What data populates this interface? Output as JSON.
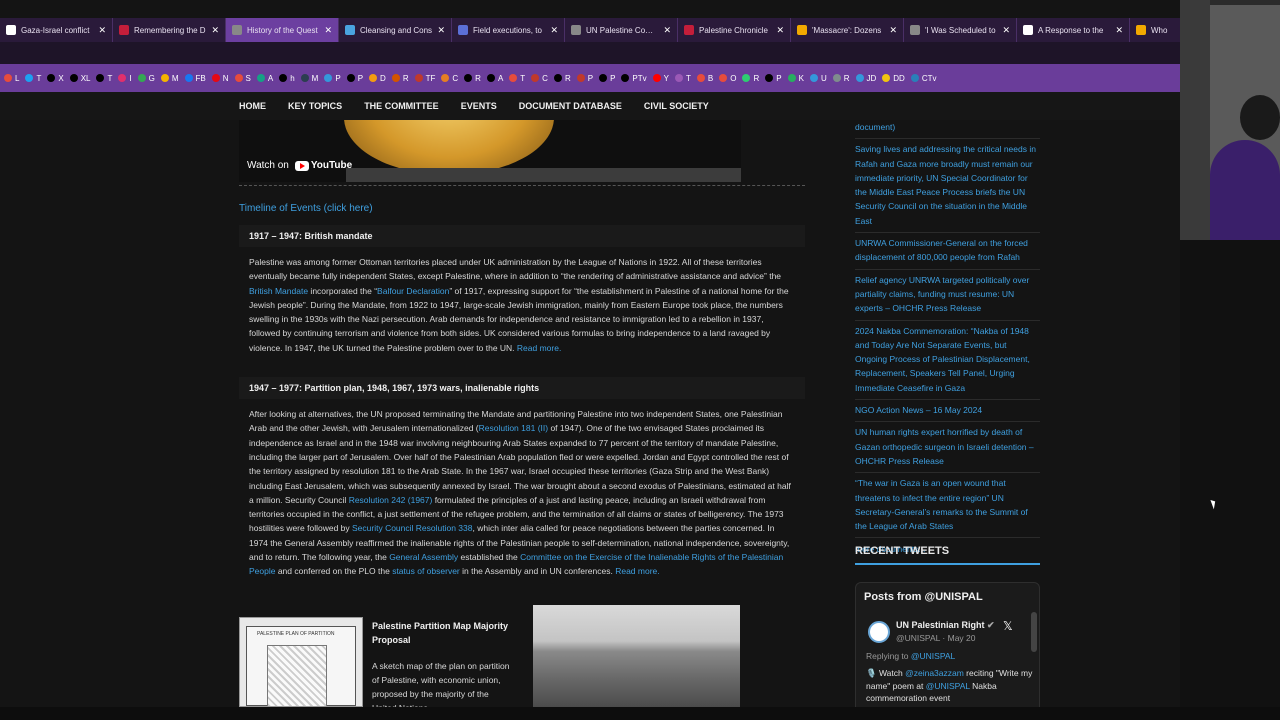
{
  "browser": {
    "tabs": [
      {
        "label": "Gaza-Israel conflict",
        "color": "#ffffff",
        "active": false
      },
      {
        "label": "Remembering the D",
        "color": "#c41e3a",
        "active": false
      },
      {
        "label": "History of the Quest",
        "color": "#888888",
        "active": true
      },
      {
        "label": "Cleansing and Cons",
        "color": "#4aa3df",
        "active": false
      },
      {
        "label": "Field executions, to",
        "color": "#5b6fd6",
        "active": false
      },
      {
        "label": "UN Palestine Commi",
        "color": "#888888",
        "active": false
      },
      {
        "label": "Palestine Chronicle",
        "color": "#c41e3a",
        "active": false
      },
      {
        "label": "'Massacre': Dozens",
        "color": "#f2a900",
        "active": false
      },
      {
        "label": "'I Was Scheduled to",
        "color": "#888888",
        "active": false
      },
      {
        "label": "A Response to the",
        "color": "#ffffff",
        "active": false
      },
      {
        "label": "Who",
        "color": "#f2a900",
        "active": false
      }
    ],
    "bookmarks": [
      {
        "label": "L",
        "color": "#e74c3c"
      },
      {
        "label": "T",
        "color": "#1da1f2"
      },
      {
        "label": "X",
        "color": "#000000"
      },
      {
        "label": "XL",
        "color": "#000000"
      },
      {
        "label": "T",
        "color": "#000000"
      },
      {
        "label": "I",
        "color": "#e1306c"
      },
      {
        "label": "G",
        "color": "#34a853"
      },
      {
        "label": "M",
        "color": "#f4b400"
      },
      {
        "label": "FB",
        "color": "#1877f2"
      },
      {
        "label": "N",
        "color": "#e50914"
      },
      {
        "label": "S",
        "color": "#e74c3c"
      },
      {
        "label": "A",
        "color": "#16a085"
      },
      {
        "label": "h",
        "color": "#000000"
      },
      {
        "label": "M",
        "color": "#2c3e50"
      },
      {
        "label": "P",
        "color": "#3498db"
      },
      {
        "label": "P",
        "color": "#000000"
      },
      {
        "label": "D",
        "color": "#f39c12"
      },
      {
        "label": "R",
        "color": "#d35400"
      },
      {
        "label": "TF",
        "color": "#c0392b"
      },
      {
        "label": "C",
        "color": "#e67e22"
      },
      {
        "label": "R",
        "color": "#000000"
      },
      {
        "label": "A",
        "color": "#000000"
      },
      {
        "label": "T",
        "color": "#e74c3c"
      },
      {
        "label": "C",
        "color": "#c0392b"
      },
      {
        "label": "R",
        "color": "#000000"
      },
      {
        "label": "P",
        "color": "#c0392b"
      },
      {
        "label": "P",
        "color": "#000000"
      },
      {
        "label": "PTv",
        "color": "#000000"
      },
      {
        "label": "Y",
        "color": "#ff0000"
      },
      {
        "label": "T",
        "color": "#9b59b6"
      },
      {
        "label": "B",
        "color": "#e74c3c"
      },
      {
        "label": "O",
        "color": "#e74c3c"
      },
      {
        "label": "R",
        "color": "#2ecc71"
      },
      {
        "label": "P",
        "color": "#000000"
      },
      {
        "label": "K",
        "color": "#27ae60"
      },
      {
        "label": "U",
        "color": "#3498db"
      },
      {
        "label": "R",
        "color": "#7f8c8d"
      },
      {
        "label": "JD",
        "color": "#3498db"
      },
      {
        "label": "DD",
        "color": "#f1c40f"
      },
      {
        "label": "CTv",
        "color": "#2980b9"
      }
    ]
  },
  "nav": {
    "items": [
      "HOME",
      "KEY TOPICS",
      "THE COMMITTEE",
      "EVENTS",
      "DOCUMENT DATABASE",
      "CIVIL SOCIETY"
    ]
  },
  "video": {
    "watch_label": "Watch on",
    "brand": "YouTube"
  },
  "main": {
    "timeline_link": "Timeline of Events (click here)",
    "section1_title": "1917 – 1947: British mandate",
    "section1": {
      "t1": "Palestine was among former Ottoman territories placed under UK administration by the League of Nations in 1922. All of these territories eventually became fully independent States, except Palestine, where in addition to “the rendering of administrative assistance and advice” the ",
      "l1": "British Mandate",
      "t2": " incorporated the “",
      "l2": "Balfour Declaration",
      "t3": "” of 1917, expressing support for “the establishment in Palestine of a national home for the Jewish people”. During the Mandate, from 1922 to 1947, large-scale Jewish immigration, mainly from Eastern Europe took place, the numbers swelling in the 1930s with the Nazi persecution. Arab demands for independence and resistance to immigration led to a rebellion in 1937, followed by continuing terrorism and violence from both sides. UK considered various formulas to bring independence to a land ravaged by violence. In 1947, the UK turned the Palestine problem over to the UN. ",
      "l3": "Read more."
    },
    "section2_title": "1947 – 1977: Partition plan, 1948, 1967, 1973 wars, inalienable rights",
    "section2": {
      "t1": "After looking at alternatives, the UN proposed terminating the Mandate and partitioning Palestine into two independent States, one Palestinian Arab and the other Jewish, with Jerusalem internationalized (",
      "l1": "Resolution 181 (II)",
      "t2": " of 1947). One of the two envisaged States proclaimed its independence as Israel and in the 1948 war involving neighbouring Arab States expanded to 77 percent of the territory of mandate Palestine, including the larger part of Jerusalem. Over half of the Palestinian Arab population fled or were expelled. Jordan and Egypt controlled the rest of the territory assigned by resolution 181 to the Arab State. In the 1967 war, Israel occupied these territories (Gaza Strip and the West Bank) including East Jerusalem, which was subsequently annexed by Israel. The war brought about a second exodus of Palestinians, estimated at half a million. Security Council ",
      "l2": "Resolution 242 (1967)",
      "t3": " formulated the principles of a just and lasting peace, including an Israeli withdrawal from territories occupied in the conflict, a just settlement of the refugee problem, and the termination of all claims or states of belligerency. The 1973 hostilities were followed by ",
      "l3": "Security Council Resolution 338",
      "t4": ", which inter alia called for peace negotiations between the parties concerned. In 1974 the General Assembly reaffirmed the inalienable rights of the Palestinian people to self-determination, national independence, sovereignty, and to return. The following year, the ",
      "l4": "General Assembly",
      "t5": " established the ",
      "l5": "Committee on the Exercise of the Inalienable Rights of the Palestinian People",
      "t6": " and conferred on the PLO the ",
      "l6": "status of observer",
      "t7": " in the Assembly and in UN conferences. ",
      "l7": "Read more."
    },
    "card": {
      "title": "Palestine Partition Map Majority Proposal",
      "desc": "A sketch map of the plan on partition of Palestine, with economic union, proposed by the majority of the United Nations",
      "map_caption": "PALESTINE PLAN OF PARTITION"
    }
  },
  "sidebar": {
    "top_fragment": "document)",
    "links": [
      "Saving lives and addressing the critical needs in Rafah and Gaza more broadly must remain our immediate priority, UN Special Coordinator for the Middle East Peace Process briefs the UN Security Council on the situation in the Middle East",
      "UNRWA Commissioner-General on the forced displacement of 800,000 people from Rafah",
      "Relief agency UNRWA targeted politically over partiality claims, funding must resume: UN experts – OHCHR Press Release",
      "2024 Nakba Commemoration: “Nakba of 1948 and Today Are Not Separate Events, but Ongoing Process of Palestinian Displacement, Replacement, Speakers Tell Panel, Urging Immediate Ceasefire in Gaza",
      "NGO Action News – 16 May 2024",
      "UN human rights expert horrified by death of Gazan orthopedic surgeon in Israeli detention – OHCHR Press Release",
      "“The war in Gaza is an open wound that threatens to infect the entire region” UN Secretary-General’s remarks to the Summit of the League of Arab States"
    ],
    "more": "more documents...",
    "recent_heading": "RECENT TWEETS",
    "tweets": {
      "header": "Posts from @UNISPAL",
      "name": "UN Palestinian Right",
      "handle": "@UNISPAL · May 20",
      "reply_label": "Replying to ",
      "reply_handle": "@UNISPAL",
      "t1": "🎙️ Watch ",
      "l1": "@zeina3azzam",
      "t2": " reciting \"Write my name\" poem at ",
      "l2": "@UNISPAL",
      "t3": " Nakba commemoration event"
    }
  }
}
